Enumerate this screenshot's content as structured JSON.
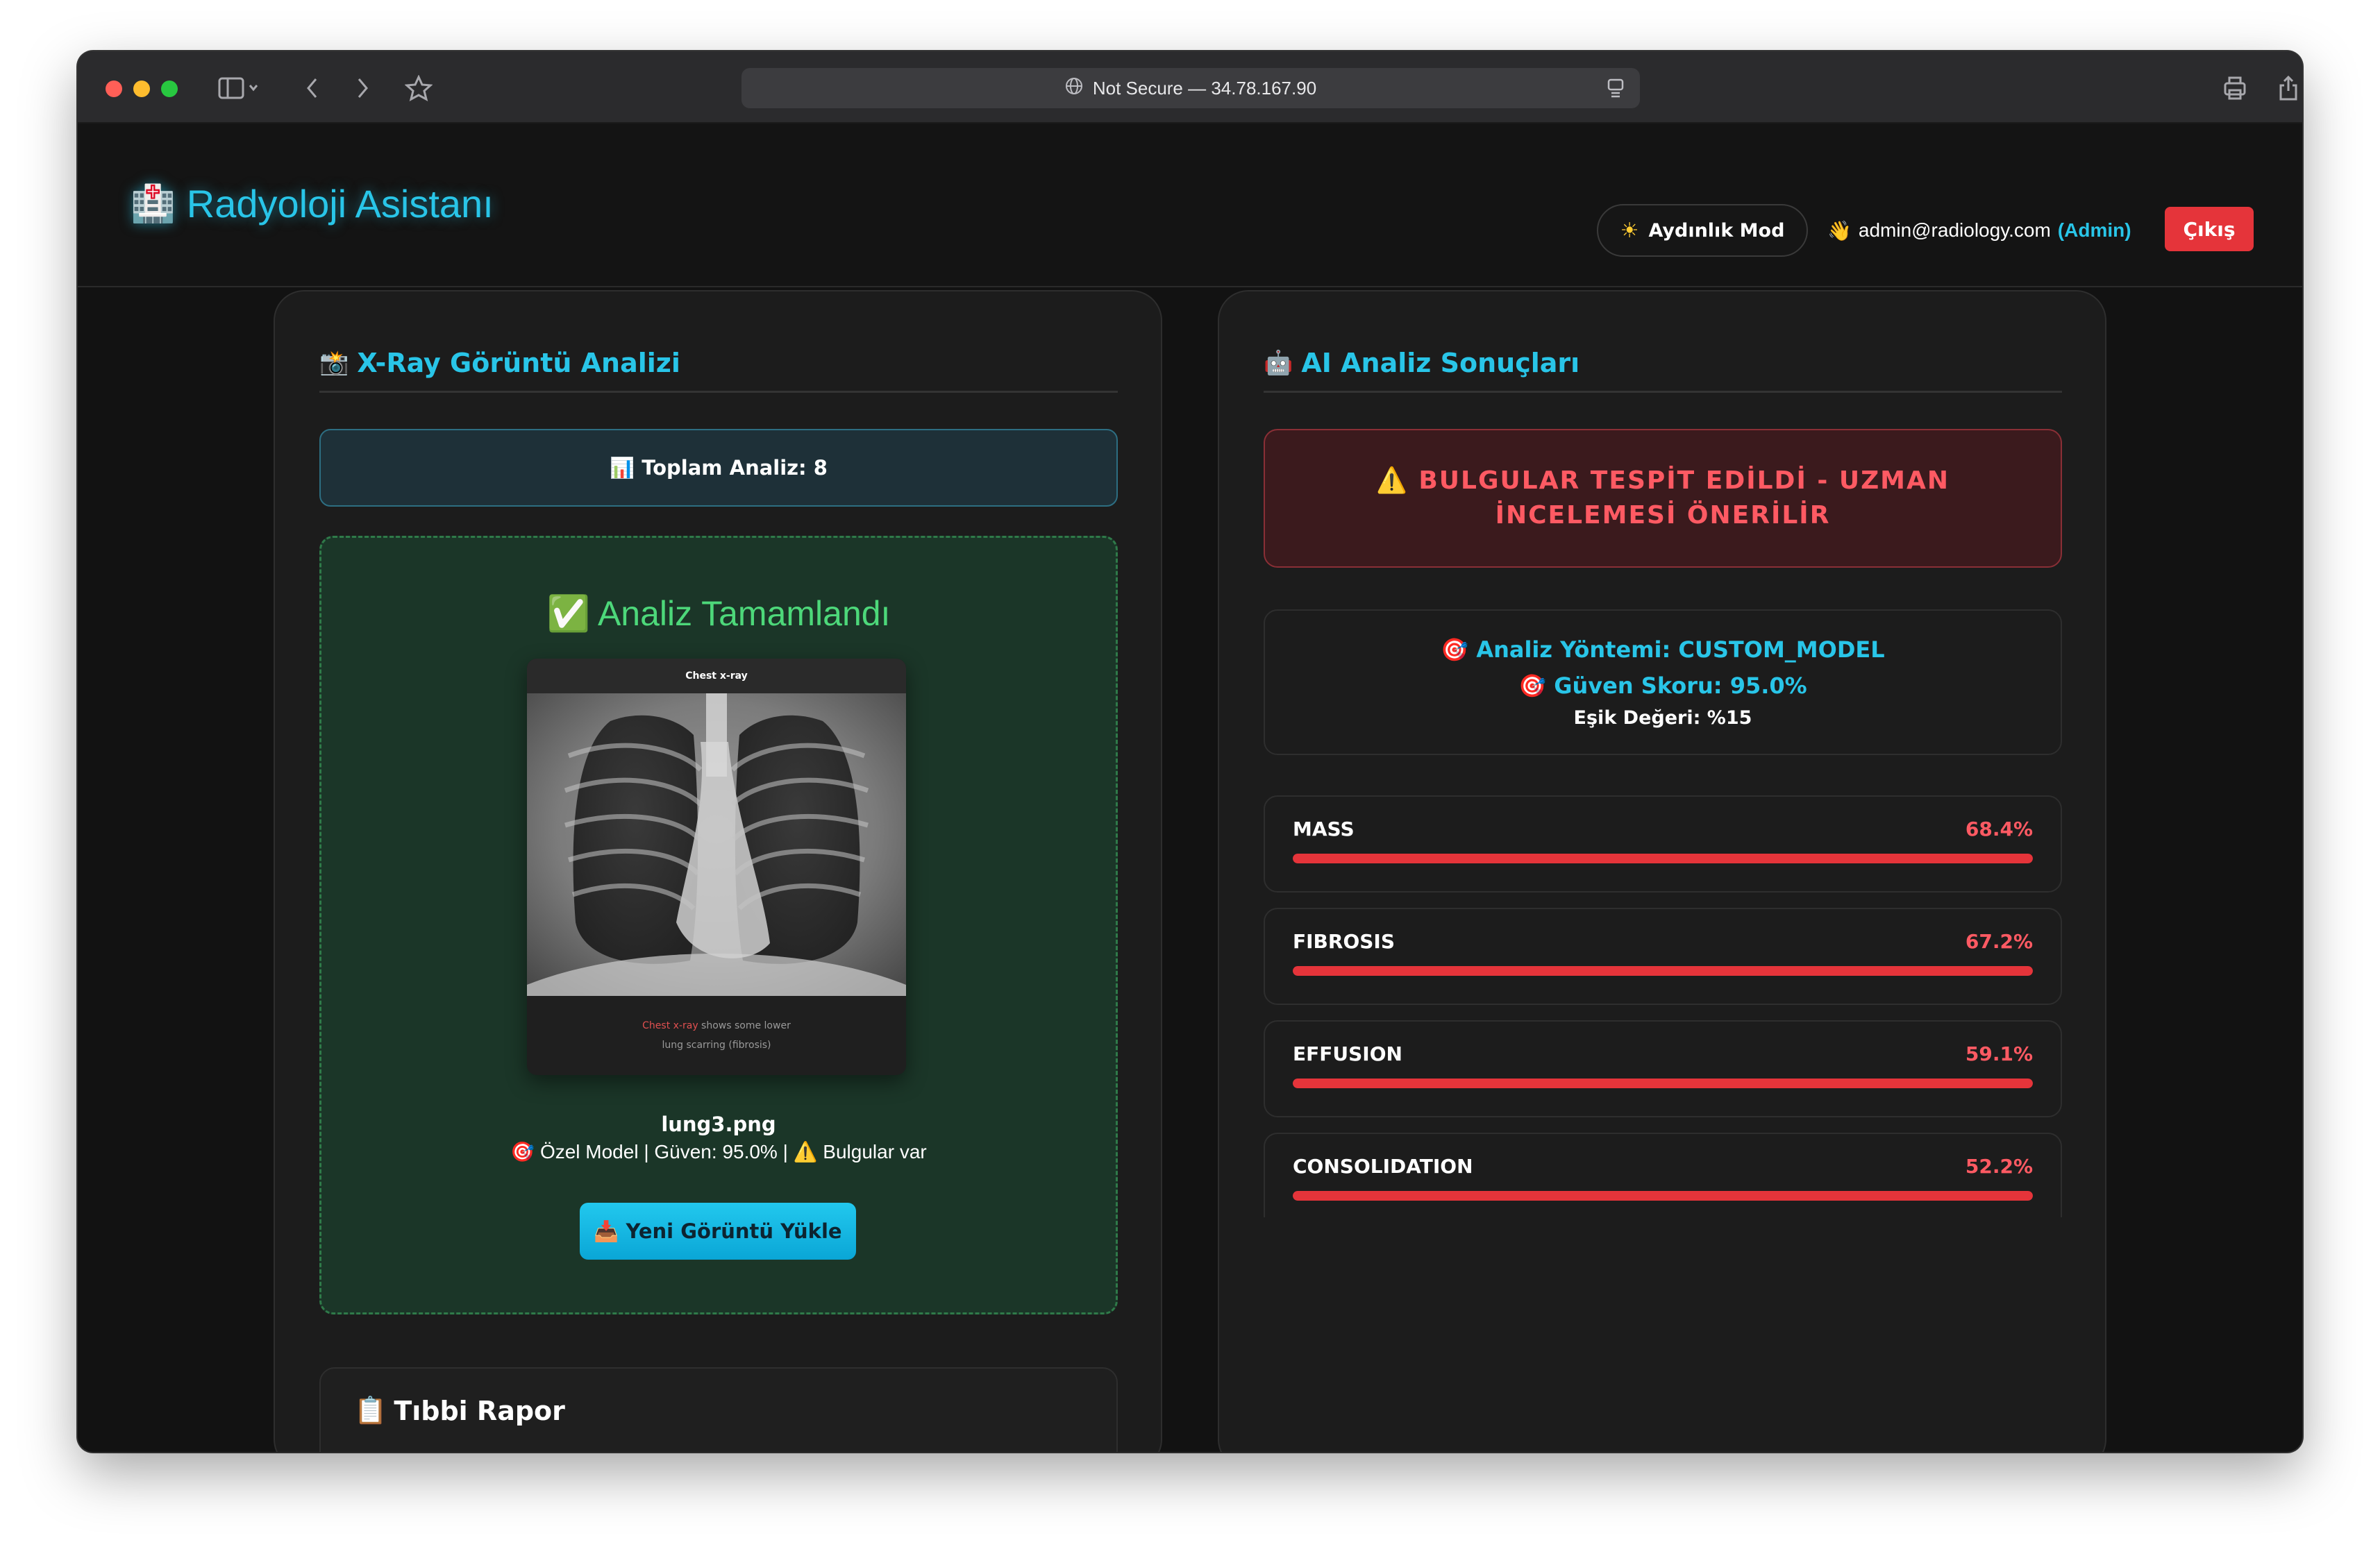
{
  "browser": {
    "address": "Not Secure — 34.78.167.90"
  },
  "header": {
    "brand": "Radyoloji Asistanı",
    "brand_icon": "hospital-icon",
    "mode_label": "Aydınlık Mod",
    "user_email": "admin@radiology.com",
    "user_role": "(Admin)",
    "logout_label": "Çıkış"
  },
  "left": {
    "title": "X-Ray Görüntü Analizi",
    "total": "Toplam Analiz: 8",
    "done_title": "Analiz Tamamlandı",
    "image_header": "Chest x-ray",
    "image_caption_red": "Chest x-ray",
    "image_caption_rest": " shows some lower",
    "image_caption_line2": "lung scarring (fibrosis)",
    "filename": "lung3.png",
    "meta": "Özel Model | Güven: 95.0% | ⚠️ Bulgular var",
    "upload_label": "Yeni Görüntü Yükle",
    "report_title": "Tıbbi Rapor"
  },
  "right": {
    "title": "AI Analiz Sonuçları",
    "alert": "BULGULAR TESPİT EDİLDİ - UZMAN İNCELEMESİ ÖNERİLİR",
    "method": "Analiz Yöntemi: CUSTOM_MODEL",
    "confidence": "Güven Skoru: 95.0%",
    "threshold": "Eşik Değeri: %15",
    "findings": [
      {
        "label": "MASS",
        "pct_text": "68.4%",
        "value": 68.4
      },
      {
        "label": "FIBROSIS",
        "pct_text": "67.2%",
        "value": 67.2
      },
      {
        "label": "EFFUSION",
        "pct_text": "59.1%",
        "value": 59.1
      },
      {
        "label": "CONSOLIDATION",
        "pct_text": "52.2%",
        "value": 52.2
      }
    ]
  },
  "colors": {
    "accent": "#29c5e8",
    "danger": "#e5343a",
    "success": "#4dd87a"
  }
}
